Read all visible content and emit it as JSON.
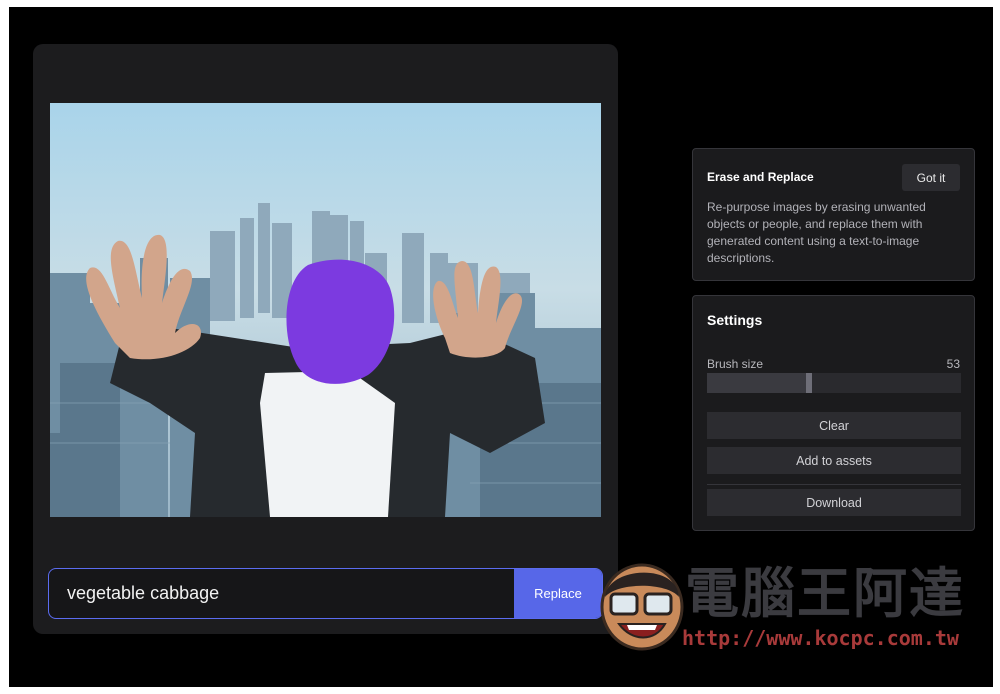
{
  "prompt": {
    "value": "vegetable cabbage",
    "replace_label": "Replace"
  },
  "info_card": {
    "title": "Erase and Replace",
    "got_it_label": "Got it",
    "description": "Re-purpose images by erasing unwanted objects or people, and replace them with generated content using a text-to-image descriptions."
  },
  "settings": {
    "title": "Settings",
    "brush_label": "Brush size",
    "brush_value": "53",
    "brush_fraction": 0.4,
    "clear_label": "Clear",
    "add_assets_label": "Add to assets",
    "download_label": "Download"
  },
  "watermark": {
    "title": "電腦王阿達",
    "url": "http://www.kocpc.com.tw"
  },
  "colors": {
    "accent": "#5767e8",
    "mask": "#7c3ae0",
    "panel": "#1c1c1e",
    "background": "#000000"
  },
  "icons": {
    "watermark_logo": "mascot-face-icon"
  }
}
